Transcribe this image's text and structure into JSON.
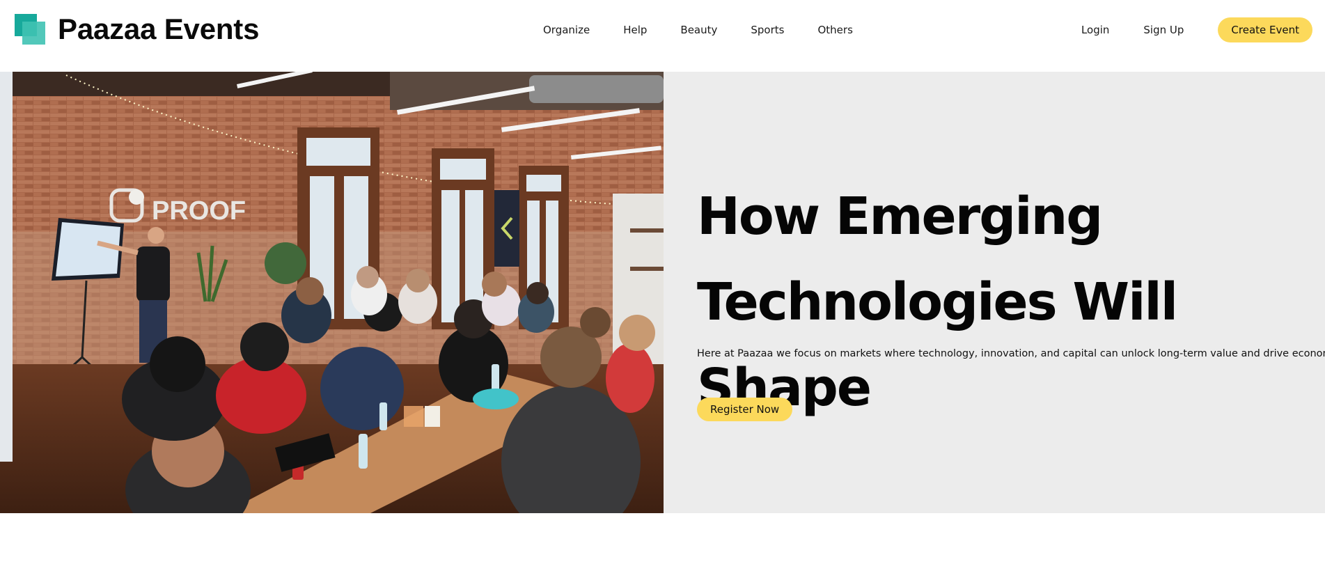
{
  "header": {
    "brand_name": "Paazaa Events",
    "brand_icon": "stacked-squares-logo",
    "nav": [
      {
        "label": "Organize"
      },
      {
        "label": "Help"
      },
      {
        "label": "Beauty"
      },
      {
        "label": "Sports"
      },
      {
        "label": "Others"
      }
    ],
    "login_label": "Login",
    "signup_label": "Sign Up",
    "create_event_label": "Create Event"
  },
  "hero": {
    "image_sign_text": "PROOF",
    "title_line1": "How Emerging",
    "title_line2": "Technologies Will Shape",
    "description": "Here at Paazaa we focus on markets where technology, innovation, and capital can unlock long-term value and drive economic growth.",
    "register_label": "Register Now"
  },
  "colors": {
    "accent_yellow": "#fcd95b",
    "brand_teal": "#17a99b",
    "hero_panel_bg": "#ececec"
  }
}
